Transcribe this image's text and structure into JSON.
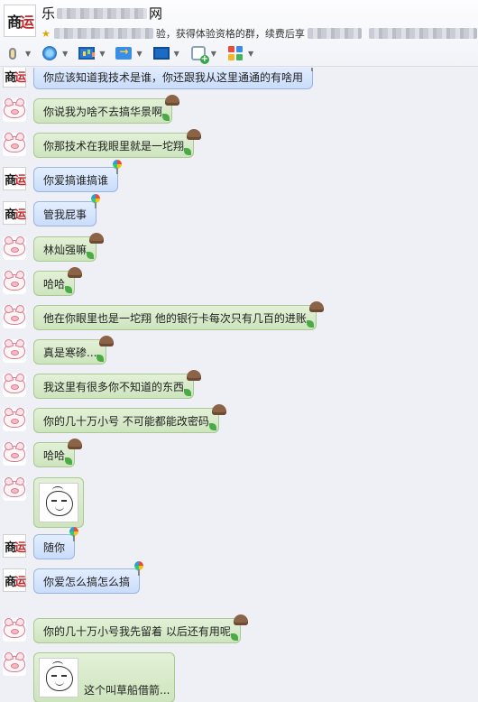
{
  "window": {
    "group_name_visible_start": "乐",
    "group_name_visible_end": "网",
    "description_visible": "验，获得体验资格的群，续费后享"
  },
  "toolbar": {
    "icons": [
      "microphone-icon",
      "video-camera-icon",
      "presentation-icon",
      "file-transfer-icon",
      "screen-share-icon",
      "group-note-icon",
      "apps-icon"
    ]
  },
  "messages": [
    {
      "avatar": "seal",
      "text": "你应该知道我技术是谁，你还跟我从这里通通的有啥用",
      "style": "blue",
      "badge": "pin"
    },
    {
      "avatar": "pig",
      "text": "你说我为啥不去搞华景啊",
      "style": "green",
      "badge": "hat"
    },
    {
      "avatar": "pig",
      "text": "你那技术在我眼里就是一坨翔",
      "style": "green",
      "badge": "hat"
    },
    {
      "avatar": "seal",
      "text": "你爱搞谁搞谁",
      "style": "blue",
      "badge": "pin"
    },
    {
      "avatar": "seal",
      "text": "管我屁事",
      "style": "blue",
      "badge": "pin"
    },
    {
      "avatar": "pig",
      "text": "林灿强嘛",
      "style": "green",
      "badge": "hat"
    },
    {
      "avatar": "pig",
      "text": "哈哈",
      "style": "green",
      "badge": "hat"
    },
    {
      "avatar": "pig",
      "text": "他在你眼里也是一坨翔 他的银行卡每次只有几百的进账",
      "style": "green",
      "badge": "hat"
    },
    {
      "avatar": "pig",
      "text": "真是寒碜...",
      "style": "green",
      "badge": "hat"
    },
    {
      "avatar": "pig",
      "text": "我这里有很多你不知道的东西",
      "style": "green",
      "badge": "hat"
    },
    {
      "avatar": "pig",
      "text": "你的几十万小号 不可能都能改密码",
      "style": "green",
      "badge": "hat"
    },
    {
      "avatar": "pig",
      "text": "哈哈",
      "style": "green",
      "badge": "hat"
    },
    {
      "avatar": "pig",
      "text": "",
      "style": "sticker",
      "badge": ""
    },
    {
      "avatar": "seal",
      "text": "随你",
      "style": "blue",
      "badge": "pin"
    },
    {
      "avatar": "seal",
      "text": "你爱怎么搞怎么搞",
      "style": "blue",
      "badge": "pin"
    },
    {
      "avatar": "pig",
      "text": "你的几十万小号我先留着 以后还有用呢",
      "style": "green",
      "badge": "hat"
    },
    {
      "avatar": "pig",
      "text": "这个叫草船借箭...",
      "style": "sticker-caption",
      "badge": ""
    }
  ]
}
